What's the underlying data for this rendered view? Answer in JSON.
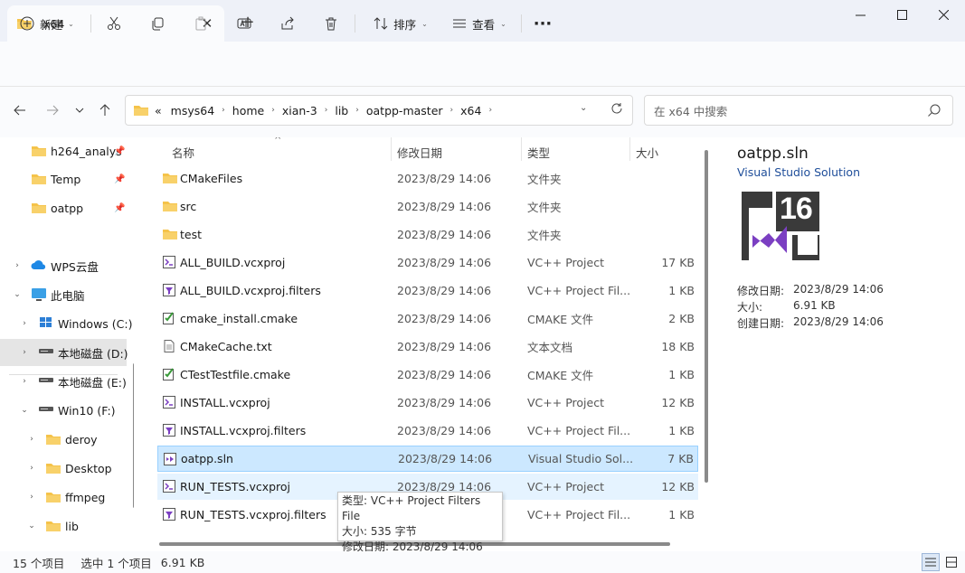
{
  "window": {
    "tab_title": "x64",
    "tab_close": "✕",
    "new_tab": "+",
    "minimize": "—",
    "maximize": "☐",
    "close": "✕"
  },
  "toolbar": {
    "new_label": "新建",
    "sort_label": "排序",
    "view_label": "查看",
    "more_label": "···"
  },
  "address": {
    "overflow": "«",
    "crumbs": [
      "msys64",
      "home",
      "xian-3",
      "lib",
      "oatpp-master",
      "x64"
    ]
  },
  "search": {
    "placeholder": "在 x64 中搜索"
  },
  "sidebar": {
    "items": [
      {
        "label": "h264_analys",
        "pinned": true
      },
      {
        "label": "Temp",
        "pinned": true
      },
      {
        "label": "oatpp",
        "pinned": true
      },
      {
        "label": "WPS云盘"
      },
      {
        "label": "此电脑"
      },
      {
        "label": "Windows (C:)"
      },
      {
        "label": "本地磁盘 (D:)"
      },
      {
        "label": "本地磁盘 (E:)"
      },
      {
        "label": "Win10 (F:)"
      },
      {
        "label": "deroy"
      },
      {
        "label": "Desktop"
      },
      {
        "label": "ffmpeg"
      },
      {
        "label": "lib"
      }
    ]
  },
  "columns": {
    "name": "名称",
    "date": "修改日期",
    "type": "类型",
    "size": "大小"
  },
  "files": [
    {
      "name": "CMakeFiles",
      "date": "2023/8/29 14:06",
      "type": "文件夹",
      "size": "",
      "icon": "folder"
    },
    {
      "name": "src",
      "date": "2023/8/29 14:06",
      "type": "文件夹",
      "size": "",
      "icon": "folder"
    },
    {
      "name": "test",
      "date": "2023/8/29 14:06",
      "type": "文件夹",
      "size": "",
      "icon": "folder"
    },
    {
      "name": "ALL_BUILD.vcxproj",
      "date": "2023/8/29 14:06",
      "type": "VC++ Project",
      "size": "17 KB",
      "icon": "vcxproj"
    },
    {
      "name": "ALL_BUILD.vcxproj.filters",
      "date": "2023/8/29 14:06",
      "type": "VC++ Project Fil...",
      "size": "1 KB",
      "icon": "filters"
    },
    {
      "name": "cmake_install.cmake",
      "date": "2023/8/29 14:06",
      "type": "CMAKE 文件",
      "size": "2 KB",
      "icon": "cmake"
    },
    {
      "name": "CMakeCache.txt",
      "date": "2023/8/29 14:06",
      "type": "文本文档",
      "size": "18 KB",
      "icon": "txt"
    },
    {
      "name": "CTestTestfile.cmake",
      "date": "2023/8/29 14:06",
      "type": "CMAKE 文件",
      "size": "1 KB",
      "icon": "cmake"
    },
    {
      "name": "INSTALL.vcxproj",
      "date": "2023/8/29 14:06",
      "type": "VC++ Project",
      "size": "12 KB",
      "icon": "vcxproj"
    },
    {
      "name": "INSTALL.vcxproj.filters",
      "date": "2023/8/29 14:06",
      "type": "VC++ Project Fil...",
      "size": "1 KB",
      "icon": "filters"
    },
    {
      "name": "oatpp.sln",
      "date": "2023/8/29 14:06",
      "type": "Visual Studio Sol...",
      "size": "7 KB",
      "icon": "sln"
    },
    {
      "name": "RUN_TESTS.vcxproj",
      "date": "2023/8/29 14:06",
      "type": "VC++ Project",
      "size": "12 KB",
      "icon": "vcxproj"
    },
    {
      "name": "RUN_TESTS.vcxproj.filters",
      "date": "2023/8/29 14:06",
      "type": "VC++ Project Fil...",
      "size": "1 KB",
      "icon": "filters"
    }
  ],
  "tooltip": {
    "line1": "类型: VC++ Project Filters File",
    "line2": "大小: 535 字节",
    "line3": "修改日期: 2023/8/29 14:06"
  },
  "details": {
    "title": "oatpp.sln",
    "subtitle": "Visual Studio Solution",
    "badge": "16",
    "props": [
      {
        "key": "修改日期:",
        "value": "2023/8/29 14:06"
      },
      {
        "key": "大小:",
        "value": "6.91 KB"
      },
      {
        "key": "创建日期:",
        "value": "2023/8/29 14:06"
      }
    ]
  },
  "status": {
    "count": "15 个项目",
    "selection": "选中 1 个项目",
    "selection_size": "6.91 KB"
  },
  "colors": {
    "folder": "#f5c34a",
    "selection_bg": "#cce8ff",
    "vs_purple": "#7b3fc2"
  }
}
